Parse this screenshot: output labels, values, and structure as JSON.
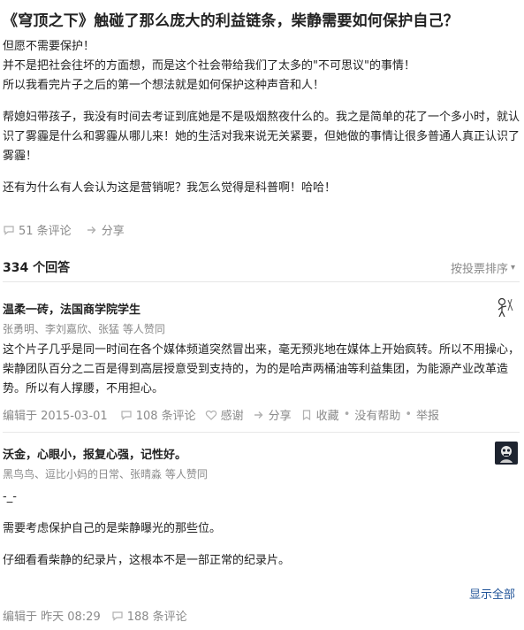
{
  "question": {
    "title": "《穹顶之下》触碰了那么庞大的利益链条，柴静需要如何保护自己？",
    "paragraphs": [
      "但愿不需要保护！",
      "并不是把社会往坏的方面想，而是这个社会带给我们了太多的\"不可思议\"的事情！",
      "所以我看完片子之后的第一个想法就是如何保护这种声音和人！",
      "",
      "帮媳妇带孩子，我没有时间去考证到底她是不是吸烟熬夜什么的。我之是简单的花了一个多小时，就认识了雾霾是什么和雾霾从哪儿来！她的生活对我来说无关紧要，但她做的事情让很多普通人真正认识了雾霾！",
      "",
      "还有为什么有人会认为这是营销呢？我怎么觉得是科普啊！哈哈！"
    ],
    "comments_label": "51 条评论",
    "share_label": "分享"
  },
  "answers_header": {
    "count_label": "334 个回答",
    "sort_label": "按投票排序"
  },
  "answers": [
    {
      "author": "温柔一砖，法国商学院学生",
      "voters": "张勇明、李刘嘉欣、张猛 等人赞同",
      "paragraphs": [
        "这个片子几乎是同一时间在各个媒体频道突然冒出来，毫无预兆地在媒体上开始疯转。所以不用操心，柴静团队百分之二百是得到高层授意受到支持的，为的是哈声两桶油等利益集团，为能源产业改革造势。所以有人撑腰，不用担心。"
      ],
      "meta": {
        "edited": "编辑于 2015-03-01",
        "comments": "108 条评论",
        "thanks": "感谢",
        "share": "分享",
        "collect": "收藏",
        "no_help": "没有帮助",
        "report": "举报"
      }
    },
    {
      "author": "沃金，心眼小，报复心强，记性好。",
      "voters": "黑鸟鸟、逗比小妈的日常、张晴淼 等人赞同",
      "paragraphs": [
        "-_-",
        "",
        "需要考虑保护自己的是柴静曝光的那些位。",
        "",
        "仔细看看柴静的纪录片，这根本不是一部正常的纪录片。"
      ],
      "show_all": "显示全部",
      "meta": {
        "edited": "编辑于 昨天 08:29",
        "comments": "188 条评论"
      }
    }
  ],
  "icons": {
    "comment": "comment-icon",
    "share": "share-icon",
    "thanks": "heart-icon",
    "collect": "bookmark-icon"
  },
  "colors": {
    "link": "#225599",
    "meta": "#8a8a8a"
  }
}
